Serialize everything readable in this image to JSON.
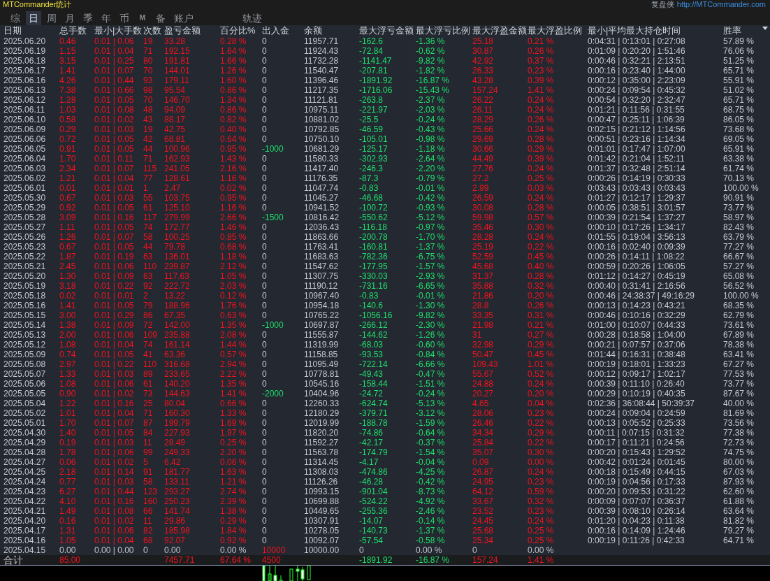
{
  "window": {
    "title": "MTCommander统计",
    "brand": "复盘侠",
    "link": "http://MTCommander.com"
  },
  "tabs": [
    {
      "label": "综",
      "selected": false
    },
    {
      "label": "日",
      "selected": true
    },
    {
      "label": "周",
      "selected": false
    },
    {
      "label": "月",
      "selected": false
    },
    {
      "label": "季",
      "selected": false
    },
    {
      "label": "年",
      "selected": false
    },
    {
      "label": "币",
      "selected": false
    },
    {
      "label": "M",
      "selected": false
    },
    {
      "label": "备",
      "selected": false
    },
    {
      "label": "账户",
      "selected": false
    }
  ],
  "extra_tabs": [
    {
      "label": "轨迹",
      "selected": false
    }
  ],
  "table": {
    "columns": [
      "日期",
      "总手数",
      "最小|大手数",
      "次数",
      "盈亏金额",
      "百分比%",
      "出入金",
      "余额",
      "最大浮亏金额",
      "最大浮亏比例",
      "最大浮盈金额",
      "最大浮盈比例",
      "最小|平均最大持仓时间",
      "胜率"
    ],
    "rows": [
      {
        "kind": "trading",
        "withdrawal": false,
        "deposit": false,
        "cells": [
          "2025.06.20",
          "0.46",
          "0.01 | 0.06",
          "19",
          "33.28",
          "0.28 %",
          "0",
          "11957.71",
          "-162.6",
          "-1.36 %",
          "25.18",
          "0.21 %",
          "0:04:31 | 0:13:01 | 0:27:08",
          "57.89 %"
        ]
      },
      {
        "kind": "trading",
        "withdrawal": false,
        "deposit": false,
        "cells": [
          "2025.06.19",
          "1.15",
          "0.01 | 0.04",
          "71",
          "192.15",
          "1.64 %",
          "0",
          "11924.43",
          "-72.84",
          "-0.62 %",
          "30.87",
          "0.26 %",
          "0:01:09 | 0:20:20 | 1:51:46",
          "76.06 %"
        ]
      },
      {
        "kind": "trading",
        "withdrawal": false,
        "deposit": false,
        "cells": [
          "2025.06.18",
          "3.15",
          "0.01 | 0.25",
          "80",
          "191.81",
          "1.66 %",
          "0",
          "11732.28",
          "-1141.47",
          "-9.82 %",
          "42.92",
          "0.37 %",
          "0:00:46 | 0:32:21 | 2:13:51",
          "51.25 %"
        ]
      },
      {
        "kind": "trading",
        "withdrawal": false,
        "deposit": false,
        "cells": [
          "2025.06.17",
          "1.41",
          "0.01 | 0.07",
          "70",
          "144.01",
          "1.26 %",
          "0",
          "11540.47",
          "-207.81",
          "-1.82 %",
          "26.33",
          "0.23 %",
          "0:00:16 | 0:23:40 | 1:44:00",
          "65.71 %"
        ]
      },
      {
        "kind": "trading",
        "withdrawal": false,
        "deposit": false,
        "cells": [
          "2025.06.16",
          "4.26",
          "0.01 | 0.44",
          "93",
          "179.11",
          "1.60 %",
          "0",
          "11396.46",
          "-1891.92",
          "-16.87 %",
          "43.28",
          "0.39 %",
          "0:00:12 | 0:35:00 | 2:23:09",
          "55.91 %"
        ]
      },
      {
        "kind": "trading",
        "withdrawal": false,
        "deposit": false,
        "cells": [
          "2025.06.13",
          "7.38",
          "0.01 | 0.66",
          "98",
          "95.54",
          "0.86 %",
          "0",
          "11217.35",
          "-1716.06",
          "-15.43 %",
          "157.24",
          "1.41 %",
          "0:00:24 | 0:09:54 | 0:45:32",
          "51.02 %"
        ]
      },
      {
        "kind": "trading",
        "withdrawal": false,
        "deposit": false,
        "cells": [
          "2025.06.12",
          "1.28",
          "0.01 | 0.05",
          "70",
          "146.70",
          "1.34 %",
          "0",
          "11121.81",
          "-263.8",
          "-2.37 %",
          "26.22",
          "0.24 %",
          "0:00:54 | 0:32:20 | 2:32:47",
          "65.71 %"
        ]
      },
      {
        "kind": "trading",
        "withdrawal": false,
        "deposit": false,
        "cells": [
          "2025.06.11",
          "1.03",
          "0.01 | 0.08",
          "48",
          "94.09",
          "0.86 %",
          "0",
          "10975.11",
          "-221.97",
          "-2.03 %",
          "26.11",
          "0.24 %",
          "0:01:21 | 0:11:56 | 0:31:55",
          "68.75 %"
        ]
      },
      {
        "kind": "trading",
        "withdrawal": false,
        "deposit": false,
        "cells": [
          "2025.06.10",
          "0.58",
          "0.01 | 0.02",
          "43",
          "88.17",
          "0.82 %",
          "0",
          "10881.02",
          "-25.5",
          "-0.24 %",
          "28.29",
          "0.26 %",
          "0:00:47 | 0:25:11 | 1:06:39",
          "86.05 %"
        ]
      },
      {
        "kind": "trading",
        "withdrawal": false,
        "deposit": false,
        "cells": [
          "2025.06.09",
          "0.29",
          "0.01 | 0.03",
          "19",
          "42.75",
          "0.40 %",
          "0",
          "10792.85",
          "-46.59",
          "-0.43 %",
          "25.66",
          "0.24 %",
          "0:02:15 | 0:21:12 | 1:14:56",
          "73.68 %"
        ]
      },
      {
        "kind": "trading",
        "withdrawal": false,
        "deposit": false,
        "cells": [
          "2025.06.06",
          "0.72",
          "0.01 | 0.05",
          "42",
          "68.81",
          "0.64 %",
          "0",
          "10750.10",
          "-105.01",
          "-0.98 %",
          "29.69",
          "0.28 %",
          "0:00:51 | 0:23:16 | 1:14:34",
          "69.05 %"
        ]
      },
      {
        "kind": "trading",
        "withdrawal": true,
        "deposit": false,
        "cells": [
          "2025.06.05",
          "0.91",
          "0.01 | 0.05",
          "44",
          "100.96",
          "0.95 %",
          "-1000",
          "10681.29",
          "-125.17",
          "-1.18 %",
          "30.66",
          "0.29 %",
          "0:01:01 | 0:17:47 | 1:07:00",
          "65.91 %"
        ]
      },
      {
        "kind": "trading",
        "withdrawal": false,
        "deposit": false,
        "cells": [
          "2025.06.04",
          "1.70",
          "0.01 | 0.11",
          "71",
          "162.93",
          "1.43 %",
          "0",
          "11580.33",
          "-302.93",
          "-2.64 %",
          "44.49",
          "0.39 %",
          "0:01:42 | 0:21:04 | 1:52:11",
          "63.38 %"
        ]
      },
      {
        "kind": "trading",
        "withdrawal": false,
        "deposit": false,
        "cells": [
          "2025.06.03",
          "2.34",
          "0.01 | 0.07",
          "115",
          "241.05",
          "2.16 %",
          "0",
          "11417.40",
          "-246.3",
          "-2.20 %",
          "27.76",
          "0.24 %",
          "0:01:37 | 0:32:48 | 2:51:14",
          "61.74 %"
        ]
      },
      {
        "kind": "trading",
        "withdrawal": false,
        "deposit": false,
        "cells": [
          "2025.06.02",
          "1.21",
          "0.01 | 0.04",
          "77",
          "128.61",
          "1.16 %",
          "0",
          "11176.35",
          "-87.3",
          "-0.79 %",
          "27.2",
          "0.25 %",
          "0:00:26 | 0:14:19 | 0:30:33",
          "70.13 %"
        ]
      },
      {
        "kind": "trading",
        "withdrawal": false,
        "deposit": false,
        "cells": [
          "2025.06.01",
          "0.01",
          "0.01 | 0.01",
          "1",
          "2.47",
          "0.02 %",
          "0",
          "11047.74",
          "-0.83",
          "-0.01 %",
          "2.99",
          "0.03 %",
          "0:03:43 | 0:03:43 | 0:03:43",
          "100.00 %"
        ]
      },
      {
        "kind": "trading",
        "withdrawal": false,
        "deposit": false,
        "cells": [
          "2025.05.30",
          "0.67",
          "0.01 | 0.03",
          "55",
          "103.75",
          "0.95 %",
          "0",
          "11045.27",
          "-46.68",
          "-0.42 %",
          "26.59",
          "0.24 %",
          "0:01:27 | 0:12:17 | 1:29:37",
          "90.91 %"
        ]
      },
      {
        "kind": "trading",
        "withdrawal": false,
        "deposit": false,
        "cells": [
          "2025.05.29",
          "0.92",
          "0.01 | 0.05",
          "61",
          "125.10",
          "1.16 %",
          "0",
          "10941.52",
          "-100.72",
          "-0.93 %",
          "30.08",
          "0.28 %",
          "0:00:05 | 0:38:51 | 3:01:57",
          "73.77 %"
        ]
      },
      {
        "kind": "trading",
        "withdrawal": true,
        "deposit": false,
        "cells": [
          "2025.05.28",
          "3.09",
          "0.01 | 0.16",
          "117",
          "279.99",
          "2.66 %",
          "-1500",
          "10816.42",
          "-550.62",
          "-5.12 %",
          "59.98",
          "0.57 %",
          "0:00:39 | 0:21:54 | 1:37:27",
          "58.97 %"
        ]
      },
      {
        "kind": "trading",
        "withdrawal": false,
        "deposit": false,
        "cells": [
          "2025.05.27",
          "1.11",
          "0.01 | 0.05",
          "74",
          "172.77",
          "1.46 %",
          "0",
          "12036.43",
          "-116.18",
          "-0.97 %",
          "35.46",
          "0.30 %",
          "0:00:10 | 0:17:26 | 1:34:17",
          "82.43 %"
        ]
      },
      {
        "kind": "trading",
        "withdrawal": false,
        "deposit": false,
        "cells": [
          "2025.05.26",
          "1.26",
          "0.01 | 0.07",
          "58",
          "100.25",
          "0.85 %",
          "0",
          "11863.66",
          "-200.78",
          "-1.70 %",
          "28.28",
          "0.24 %",
          "0:01:55 | 0:19:04 | 3:56:13",
          "63.79 %"
        ]
      },
      {
        "kind": "trading",
        "withdrawal": false,
        "deposit": false,
        "cells": [
          "2025.05.23",
          "0.67",
          "0.01 | 0.05",
          "44",
          "79.78",
          "0.68 %",
          "0",
          "11763.41",
          "-160.81",
          "-1.37 %",
          "25.19",
          "0.22 %",
          "0:00:16 | 0:02:40 | 0:09:39",
          "77.27 %"
        ]
      },
      {
        "kind": "trading",
        "withdrawal": false,
        "deposit": false,
        "cells": [
          "2025.05.22",
          "1.87",
          "0.01 | 0.19",
          "63",
          "136.01",
          "1.18 %",
          "0",
          "11683.63",
          "-782.36",
          "-6.75 %",
          "52.59",
          "0.45 %",
          "0:00:26 | 0:14:11 | 1:08:22",
          "66.67 %"
        ]
      },
      {
        "kind": "trading",
        "withdrawal": false,
        "deposit": false,
        "cells": [
          "2025.05.21",
          "2.45",
          "0.01 | 0.06",
          "110",
          "239.87",
          "2.12 %",
          "0",
          "11547.62",
          "-177.95",
          "-1.57 %",
          "45.68",
          "0.40 %",
          "0:00:59 | 0:20:26 | 1:06:05",
          "57.27 %"
        ]
      },
      {
        "kind": "trading",
        "withdrawal": false,
        "deposit": false,
        "cells": [
          "2025.05.20",
          "1.30",
          "0.01 | 0.09",
          "63",
          "117.63",
          "1.05 %",
          "0",
          "11307.75",
          "-330.03",
          "-2.93 %",
          "31.37",
          "0.28 %",
          "0:01:12 | 0:14:27 | 0:45:19",
          "65.08 %"
        ]
      },
      {
        "kind": "trading",
        "withdrawal": false,
        "deposit": false,
        "cells": [
          "2025.05.19",
          "3.18",
          "0.01 | 0.22",
          "92",
          "222.72",
          "2.03 %",
          "0",
          "11190.12",
          "-731.16",
          "-6.65 %",
          "35.88",
          "0.32 %",
          "0:00:40 | 0:31:41 | 2:16:56",
          "56.52 %"
        ]
      },
      {
        "kind": "trading",
        "withdrawal": false,
        "deposit": false,
        "cells": [
          "2025.05.18",
          "0.02",
          "0.01 | 0.01",
          "2",
          "13.22",
          "0.12 %",
          "0",
          "10967.40",
          "-0.83",
          "-0.01 %",
          "21.86",
          "0.20 %",
          "0:00:46 | 24:38:37 | 49:16:29",
          "100.00 %"
        ]
      },
      {
        "kind": "trading",
        "withdrawal": false,
        "deposit": false,
        "cells": [
          "2025.05.16",
          "1.41",
          "0.01 | 0.05",
          "79",
          "188.96",
          "1.76 %",
          "0",
          "10954.18",
          "-140.6",
          "-1.30 %",
          "28.8",
          "0.26 %",
          "0:00:13 | 0:14:23 | 0:43:21",
          "68.35 %"
        ]
      },
      {
        "kind": "trading",
        "withdrawal": false,
        "deposit": false,
        "cells": [
          "2025.05.15",
          "3.00",
          "0.01 | 0.29",
          "86",
          "67.35",
          "0.63 %",
          "0",
          "10765.22",
          "-1056.16",
          "-9.82 %",
          "33.35",
          "0.31 %",
          "0:00:46 | 0:10:16 | 0:32:29",
          "62.79 %"
        ]
      },
      {
        "kind": "trading",
        "withdrawal": true,
        "deposit": false,
        "cells": [
          "2025.05.14",
          "1.38",
          "0.01 | 0.09",
          "72",
          "142.00",
          "1.35 %",
          "-1000",
          "10697.87",
          "-266.12",
          "-2.30 %",
          "21.98",
          "0.21 %",
          "0:01:00 | 0:10:07 | 0:44:33",
          "73.61 %"
        ]
      },
      {
        "kind": "trading",
        "withdrawal": false,
        "deposit": false,
        "cells": [
          "2025.05.13",
          "2.00",
          "0.01 | 0.06",
          "109",
          "235.88",
          "2.08 %",
          "0",
          "11555.87",
          "-144.62",
          "-1.26 %",
          "31",
          "0.27 %",
          "0:00:28 | 0:18:58 | 1:04:00",
          "67.89 %"
        ]
      },
      {
        "kind": "trading",
        "withdrawal": false,
        "deposit": false,
        "cells": [
          "2025.05.12",
          "1.08",
          "0.01 | 0.04",
          "74",
          "161.14",
          "1.44 %",
          "0",
          "11319.99",
          "-68.03",
          "-0.60 %",
          "32.98",
          "0.29 %",
          "0:00:21 | 0:07:57 | 0:37:06",
          "78.38 %"
        ]
      },
      {
        "kind": "trading",
        "withdrawal": false,
        "deposit": false,
        "cells": [
          "2025.05.09",
          "0.74",
          "0.01 | 0.05",
          "41",
          "63.36",
          "0.57 %",
          "0",
          "11158.85",
          "-93.53",
          "-0.84 %",
          "50.47",
          "0.45 %",
          "0:01:44 | 0:16:31 | 0:38:48",
          "63.41 %"
        ]
      },
      {
        "kind": "trading",
        "withdrawal": false,
        "deposit": false,
        "cells": [
          "2025.05.08",
          "2.97",
          "0.01 | 0.22",
          "110",
          "316.68",
          "2.94 %",
          "0",
          "11095.49",
          "-722.14",
          "-6.66 %",
          "109.43",
          "1.01 %",
          "0:00:19 | 0:18:01 | 1:33:23",
          "67.27 %"
        ]
      },
      {
        "kind": "trading",
        "withdrawal": false,
        "deposit": false,
        "cells": [
          "2025.05.07",
          "1.33",
          "0.01 | 0.03",
          "89",
          "233.65",
          "2.22 %",
          "0",
          "10778.81",
          "-49.43",
          "-0.47 %",
          "55.67",
          "0.52 %",
          "0:00:12 | 0:09:17 | 1:02:17",
          "77.53 %"
        ]
      },
      {
        "kind": "trading",
        "withdrawal": false,
        "deposit": false,
        "cells": [
          "2025.05.06",
          "1.08",
          "0.01 | 0.06",
          "61",
          "140.20",
          "1.35 %",
          "0",
          "10545.16",
          "-158.44",
          "-1.51 %",
          "24.88",
          "0.24 %",
          "0:00:39 | 0:11:10 | 0:26:40",
          "73.77 %"
        ]
      },
      {
        "kind": "trading",
        "withdrawal": true,
        "deposit": false,
        "cells": [
          "2025.05.05",
          "0.90",
          "0.01 | 0.02",
          "73",
          "144.63",
          "1.41 %",
          "-2000",
          "10404.96",
          "-24.72",
          "-0.24 %",
          "20.27",
          "0.20 %",
          "0:00:29 | 0:10:19 | 0:40:35",
          "87.67 %"
        ]
      },
      {
        "kind": "trading",
        "withdrawal": false,
        "deposit": false,
        "cells": [
          "2025.05.04",
          "1.22",
          "0.01 | 0.16",
          "25",
          "80.04",
          "0.66 %",
          "0",
          "12260.33",
          "-624.74",
          "-5.13 %",
          "4.65",
          "0.04 %",
          "0:02:36 | 36:08:44 | 50:39:37",
          "40.00 %"
        ]
      },
      {
        "kind": "trading",
        "withdrawal": false,
        "deposit": false,
        "cells": [
          "2025.05.02",
          "1.01",
          "0.01 | 0.04",
          "71",
          "160.30",
          "1.33 %",
          "0",
          "12180.29",
          "-379.71",
          "-3.12 %",
          "28.06",
          "0.23 %",
          "0:00:24 | 0:09:04 | 0:24:59",
          "81.69 %"
        ]
      },
      {
        "kind": "trading",
        "withdrawal": false,
        "deposit": false,
        "cells": [
          "2025.05.01",
          "1.70",
          "0.01 | 0.07",
          "87",
          "199.79",
          "1.69 %",
          "0",
          "12019.99",
          "-188.78",
          "-1.59 %",
          "26.46",
          "0.22 %",
          "0:00:13 | 0:05:52 | 0:25:33",
          "73.56 %"
        ]
      },
      {
        "kind": "trading",
        "withdrawal": false,
        "deposit": false,
        "cells": [
          "2025.04.30",
          "1.40",
          "0.01 | 0.05",
          "84",
          "227.93",
          "1.97 %",
          "0",
          "11820.20",
          "-74.86",
          "-0.64 %",
          "34.34",
          "0.29 %",
          "0:00:11 | 0:07:15 | 0:31:32",
          "77.38 %"
        ]
      },
      {
        "kind": "trading",
        "withdrawal": false,
        "deposit": false,
        "cells": [
          "2025.04.29",
          "0.19",
          "0.01 | 0.03",
          "11",
          "28.49",
          "0.25 %",
          "0",
          "11592.27",
          "-42.17",
          "-0.37 %",
          "25.84",
          "0.22 %",
          "0:00:17 | 0:11:21 | 0:24:56",
          "72.73 %"
        ]
      },
      {
        "kind": "trading",
        "withdrawal": false,
        "deposit": false,
        "cells": [
          "2025.04.28",
          "1.78",
          "0.01 | 0.06",
          "99",
          "249.33",
          "2.20 %",
          "0",
          "11563.78",
          "-174.79",
          "-1.54 %",
          "35.07",
          "0.30 %",
          "0:00:20 | 0:15:43 | 1:29:52",
          "74.75 %"
        ]
      },
      {
        "kind": "trading",
        "withdrawal": false,
        "deposit": false,
        "cells": [
          "2025.04.27",
          "0.06",
          "0.01 | 0.02",
          "5",
          "6.42",
          "0.06 %",
          "0",
          "11314.45",
          "-4.17",
          "-0.04 %",
          "0.09",
          "0.00 %",
          "0:00:42 | 0:01:24 | 0:01:45",
          "80.00 %"
        ]
      },
      {
        "kind": "trading",
        "withdrawal": false,
        "deposit": false,
        "cells": [
          "2025.04.25",
          "2.18",
          "0.01 | 0.14",
          "91",
          "181.77",
          "1.63 %",
          "0",
          "11308.03",
          "-474.86",
          "-4.25 %",
          "26.87",
          "0.24 %",
          "0:00:18 | 0:15:49 | 0:44:15",
          "67.03 %"
        ]
      },
      {
        "kind": "trading",
        "withdrawal": false,
        "deposit": false,
        "cells": [
          "2025.04.24",
          "0.77",
          "0.01 | 0.03",
          "58",
          "133.11",
          "1.21 %",
          "0",
          "11126.26",
          "-46.28",
          "-0.42 %",
          "24.95",
          "0.23 %",
          "0:00:19 | 0:04:56 | 0:17:33",
          "87.93 %"
        ]
      },
      {
        "kind": "trading",
        "withdrawal": false,
        "deposit": false,
        "cells": [
          "2025.04.23",
          "6.27",
          "0.01 | 0.44",
          "123",
          "293.27",
          "2.74 %",
          "0",
          "10993.15",
          "-901.04",
          "-8.73 %",
          "64.12",
          "0.59 %",
          "0:00:20 | 0:09:53 | 0:31:22",
          "62.60 %"
        ]
      },
      {
        "kind": "trading",
        "withdrawal": false,
        "deposit": false,
        "cells": [
          "2025.04.22",
          "4.10",
          "0.01 | 0.16",
          "160",
          "250.23",
          "2.39 %",
          "0",
          "10699.88",
          "-524.22",
          "-4.92 %",
          "33.67",
          "0.32 %",
          "0:00:09 | 0:07:07 | 0:36:37",
          "61.88 %"
        ]
      },
      {
        "kind": "trading",
        "withdrawal": false,
        "deposit": false,
        "cells": [
          "2025.04.21",
          "1.49",
          "0.01 | 0.08",
          "66",
          "141.74",
          "1.38 %",
          "0",
          "10449.65",
          "-255.36",
          "-2.46 %",
          "23.52",
          "0.23 %",
          "0:00:39 | 0:08:10 | 0:26:14",
          "63.64 %"
        ]
      },
      {
        "kind": "trading",
        "withdrawal": false,
        "deposit": false,
        "cells": [
          "2025.04.20",
          "0.16",
          "0.01 | 0.02",
          "11",
          "29.86",
          "0.29 %",
          "0",
          "10307.91",
          "-14.07",
          "-0.14 %",
          "24.45",
          "0.24 %",
          "0:01:20 | 0:04:23 | 0:11:38",
          "81.82 %"
        ]
      },
      {
        "kind": "trading",
        "withdrawal": false,
        "deposit": false,
        "cells": [
          "2025.04.17",
          "1.31",
          "0.01 | 0.06",
          "82",
          "185.98",
          "1.84 %",
          "0",
          "10278.05",
          "-140.73",
          "-1.37 %",
          "25.68",
          "0.25 %",
          "0:00:16 | 0:14:09 | 1:24:46",
          "79.27 %"
        ]
      },
      {
        "kind": "trading",
        "withdrawal": false,
        "deposit": false,
        "cells": [
          "2025.04.16",
          "1.05",
          "0.01 | 0.04",
          "68",
          "92.07",
          "0.92 %",
          "0",
          "10092.07",
          "-57.54",
          "-0.58 %",
          "25.34",
          "0.25 %",
          "0:00:19 | 0:11:26 | 0:42:33",
          "64.71 %"
        ]
      },
      {
        "kind": "empty",
        "withdrawal": false,
        "deposit": true,
        "cells": [
          "2025.04.15",
          "0.00",
          "0.00 | 0.00",
          "0",
          "0.00",
          "0.00 %",
          "10000",
          "10000.00",
          "0",
          "0.00 %",
          "0",
          "0.00 %"
        ]
      }
    ],
    "total": {
      "label": "合计",
      "total_lots": "85.00",
      "profit": "7457.71",
      "percent": "67.64 %",
      "flow": "4500",
      "deposit": true,
      "max_float_loss": "-1891.92",
      "max_float_loss_pct": "-16.87 %",
      "max_float_profit": "157.24",
      "max_float_profit_pct": "1.41 %"
    }
  }
}
